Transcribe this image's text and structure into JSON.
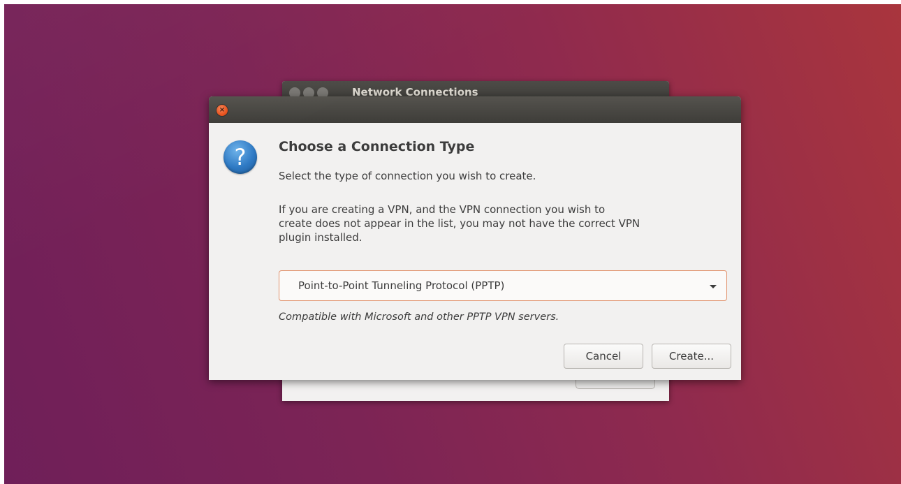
{
  "background_window": {
    "title": "Network Connections"
  },
  "dialog": {
    "close_label": "×",
    "icon_glyph": "?",
    "heading": "Choose a Connection Type",
    "subtitle": "Select the type of connection you wish to create.",
    "vpn_note_lines": [
      "If you are creating a VPN, and the VPN connection you wish to",
      "create does not appear in the list, you may not have the correct VPN",
      "plugin installed."
    ],
    "connection_type": {
      "selected": "Point-to-Point Tunneling Protocol (PPTP)",
      "description": "Compatible with Microsoft and other PPTP VPN servers."
    },
    "buttons": {
      "cancel": "Cancel",
      "create": "Create..."
    }
  },
  "colors": {
    "close_button": "#e9541f",
    "question_icon": "#2f7ac4",
    "combo_focus_border": "#e1926c",
    "titlebar": "#3e3d39"
  },
  "icons": {
    "close": "close-icon",
    "dialog": "question-icon",
    "dropdown": "chevron-down-icon"
  }
}
